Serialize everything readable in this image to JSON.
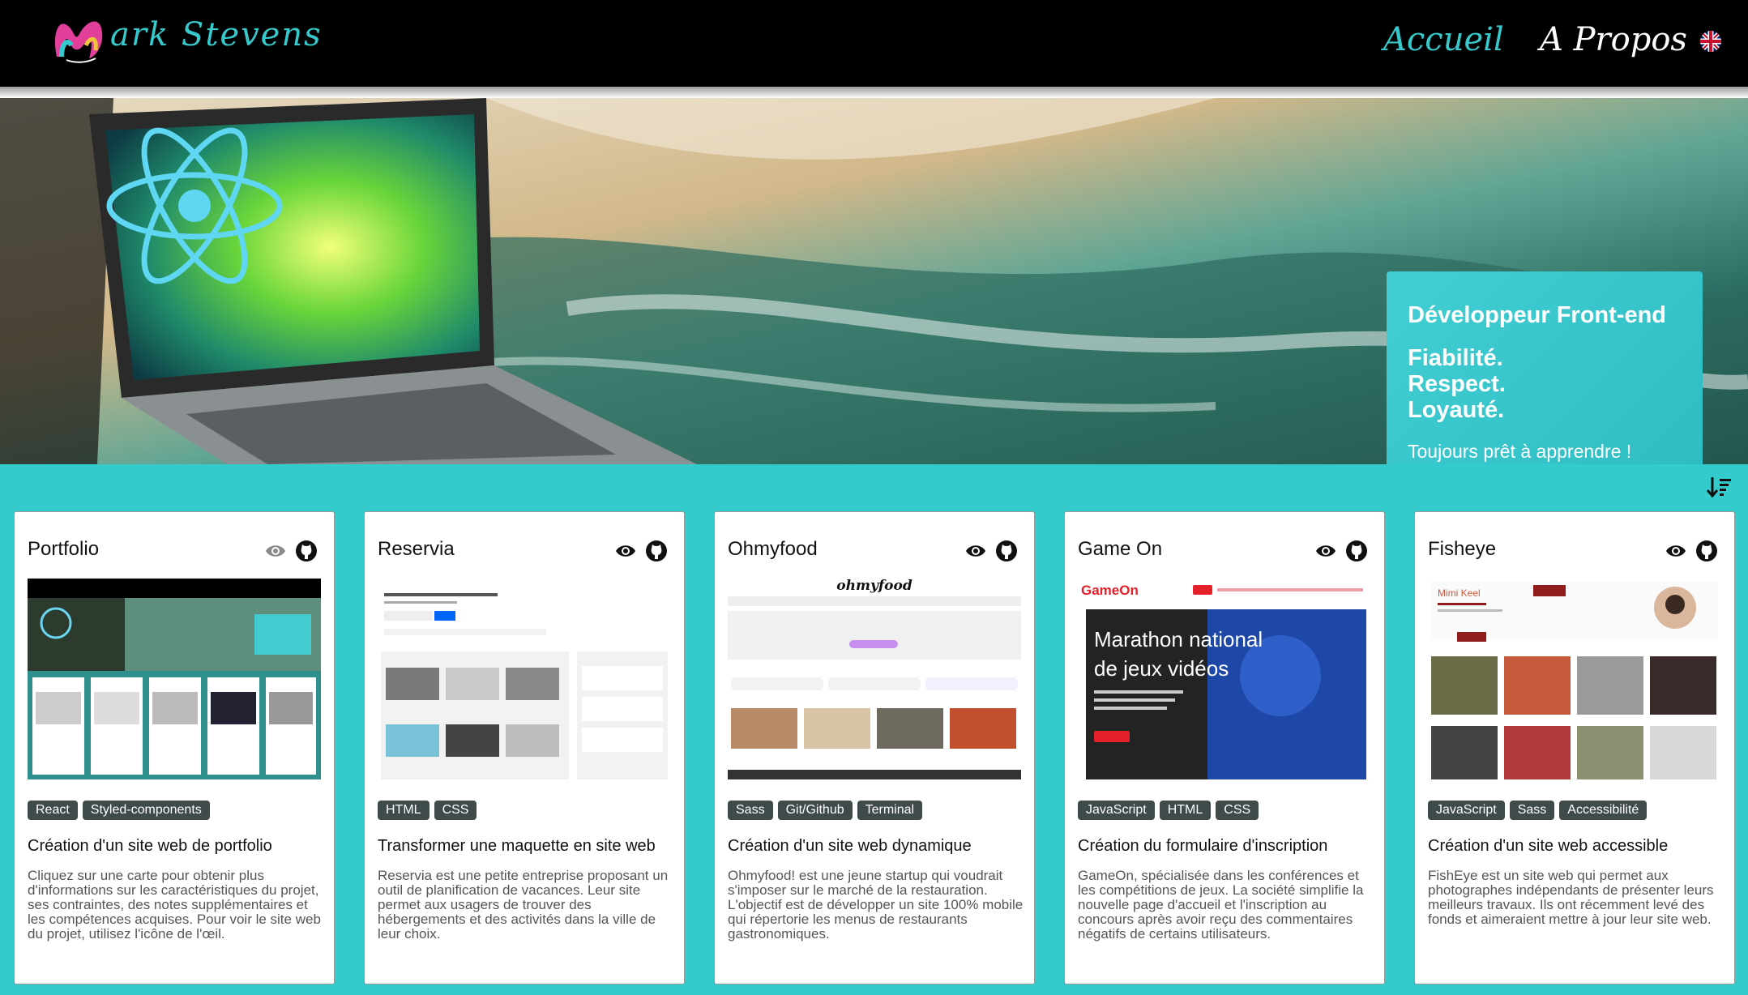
{
  "header": {
    "logo_text": "ark Stevens",
    "nav": {
      "home": "Accueil",
      "about": "A Propos"
    },
    "lang_icon": "uk-flag-icon"
  },
  "hero": {
    "title": "Développeur Front-end",
    "values": [
      "Fiabilité.",
      "Respect.",
      "Loyauté."
    ],
    "tagline": "Toujours prêt à apprendre !"
  },
  "projects": [
    {
      "title": "Portfolio",
      "tags": [
        "React",
        "Styled-components"
      ],
      "heading": "Création d'un site web de portfolio",
      "description": "Cliquez sur une carte pour obtenir plus d'informations sur les caractéristiques du projet, ses contraintes, des notes supplémentaires et les compétences acquises. Pour voir le site web du projet, utilisez l'icône de l'œil."
    },
    {
      "title": "Reservia",
      "tags": [
        "HTML",
        "CSS"
      ],
      "heading": "Transformer une maquette en site web",
      "description": "Reservia est une petite entreprise proposant un outil de planification de vacances. Leur site permet aux usagers de trouver des hébergements et des activités dans la ville de leur choix."
    },
    {
      "title": "Ohmyfood",
      "tags": [
        "Sass",
        "Git/Github",
        "Terminal"
      ],
      "heading": "Création d'un site web dynamique",
      "description": "Ohmyfood! est une jeune startup qui voudrait s'imposer sur le marché de la restauration. L'objectif est de développer un site 100% mobile qui répertorie les menus de restaurants gastronomiques."
    },
    {
      "title": "Game On",
      "tags": [
        "JavaScript",
        "HTML",
        "CSS"
      ],
      "heading": "Création du formulaire d'inscription",
      "description": "GameOn, spécialisée dans les conférences et les compétitions de jeux. La société simplifie la nouvelle page d'accueil et l'inscription au concours après avoir reçu des commentaires négatifs de certains utilisateurs."
    },
    {
      "title": "Fisheye",
      "tags": [
        "JavaScript",
        "Sass",
        "Accessibilité"
      ],
      "heading": "Création d'un site web accessible",
      "description": "FishEye est un site web qui permet aux photographes indépendants de présenter leurs meilleurs travaux. Ils ont récemment levé des fonds et aimeraient mettre à jour leur site web."
    }
  ],
  "screenshots": {
    "ohmyfood_logo": "ohmyfood",
    "gameon_logo": "GameOn",
    "gameon_headline": [
      "Marathon national",
      "de jeux vidéos"
    ],
    "fisheye_name": "Mimi Keel"
  },
  "colors": {
    "accent": "#37c9cc",
    "header_bg": "#000000",
    "tag_bg": "#3f4a4a"
  }
}
